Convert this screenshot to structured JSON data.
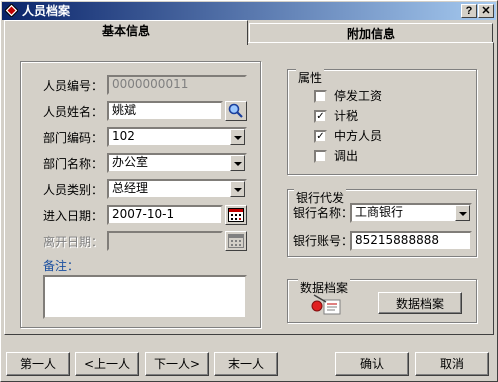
{
  "window": {
    "title": "人员档案",
    "help_label": "?",
    "close_label": "✕"
  },
  "tabs": [
    {
      "label": "基本信息"
    },
    {
      "label": "附加信息"
    }
  ],
  "basic": {
    "id_label": "人员编号：",
    "id_value": "0000000011",
    "name_label": "人员姓名：",
    "name_value": "姚斌",
    "dept_code_label": "部门编码：",
    "dept_code_value": "102",
    "dept_name_label": "部门名称：",
    "dept_name_value": "办公室",
    "category_label": "人员类别：",
    "category_value": "总经理",
    "join_date_label": "进入日期：",
    "join_date_value": "2007-10-1",
    "leave_date_label": "离开日期：",
    "leave_date_value": "",
    "note_label": "备注：",
    "note_value": ""
  },
  "attributes": {
    "title": "属性",
    "items": [
      {
        "label": "停发工资",
        "checked": false
      },
      {
        "label": "计税",
        "checked": true
      },
      {
        "label": "中方人员",
        "checked": true
      },
      {
        "label": "调出",
        "checked": false
      }
    ]
  },
  "bank": {
    "title": "银行代发",
    "bank_name_label": "银行名称：",
    "bank_name_value": "工商银行",
    "account_label": "银行账号：",
    "account_value": "85215888888"
  },
  "archive": {
    "title": "数据档案",
    "button_label": "数据档案"
  },
  "footer": {
    "first_label": "第一人",
    "prev_label": "<上一人",
    "next_label": "下一人>",
    "last_label": "末一人",
    "ok_label": "确认",
    "cancel_label": "取消"
  },
  "icons": {
    "title": "diamond-app-icon",
    "search": "magnifier-icon",
    "calendar": "calendar-icon",
    "archive": "archive-doc-icon"
  }
}
